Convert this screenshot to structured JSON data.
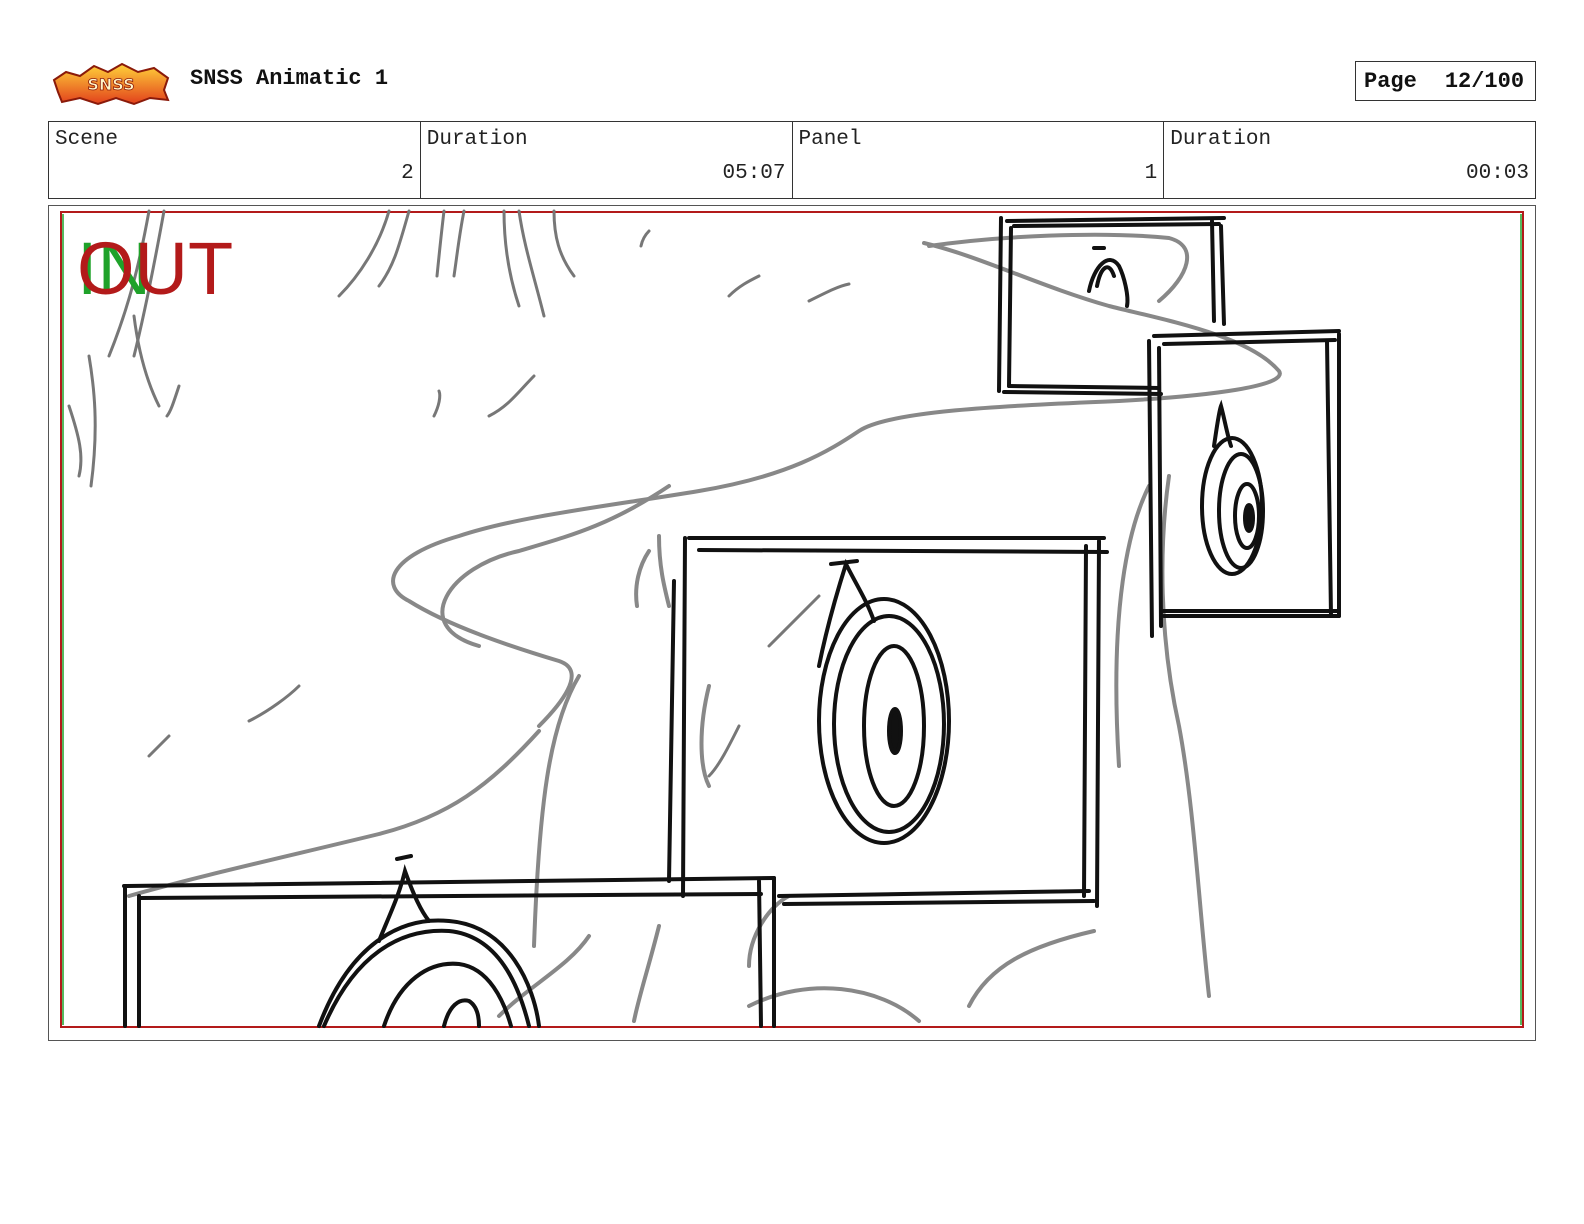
{
  "header": {
    "logo_alt": "Super Ninja Sock Style logo",
    "logo_text": "SNSS",
    "title": "SNSS Animatic 1",
    "page_label": "Page",
    "page_number": "12/100"
  },
  "info": {
    "scene_label": "Scene",
    "scene_value": "2",
    "scene_duration_label": "Duration",
    "scene_duration_value": "05:07",
    "panel_label": "Panel",
    "panel_value": "1",
    "panel_duration_label": "Duration",
    "panel_duration_value": "00:03"
  },
  "panel": {
    "in_label": "IN",
    "out_label": "OUT",
    "safe_frame_color": "#b31a1a",
    "in_marker_color": "#1fa22a",
    "sketch_description_icon": "storyboard-sketch-icon"
  }
}
